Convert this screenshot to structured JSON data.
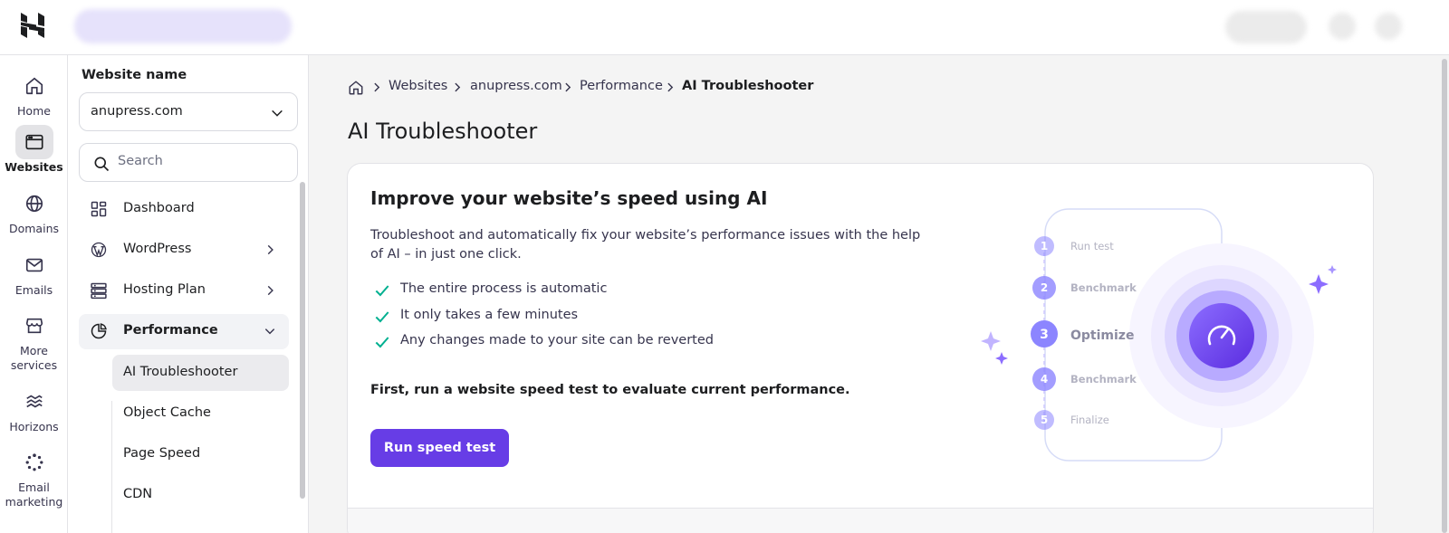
{
  "rail": [
    {
      "label": "Home",
      "icon": "home-icon"
    },
    {
      "label": "Websites",
      "icon": "browser-window-icon",
      "active": true
    },
    {
      "label": "Domains",
      "icon": "globe-icon"
    },
    {
      "label": "Emails",
      "icon": "mail-icon"
    },
    {
      "label": "More services",
      "icon": "store-icon"
    },
    {
      "label": "Horizons",
      "icon": "waves-icon"
    },
    {
      "label": "Email marketing",
      "icon": "loader-icon"
    }
  ],
  "sidebar": {
    "title": "Website name",
    "selected_site": "anupress.com",
    "search_placeholder": "Search",
    "items": [
      {
        "label": "Dashboard",
        "icon": "dashboard-icon"
      },
      {
        "label": "WordPress",
        "icon": "wordpress-icon"
      },
      {
        "label": "Hosting Plan",
        "icon": "server-icon"
      },
      {
        "label": "Performance",
        "icon": "pie-chart-icon",
        "expanded": true
      }
    ],
    "sub_items": [
      {
        "label": "AI Troubleshooter",
        "active": true
      },
      {
        "label": "Object Cache"
      },
      {
        "label": "Page Speed"
      },
      {
        "label": "CDN"
      }
    ]
  },
  "breadcrumb": [
    "Websites",
    "anupress.com",
    "Performance",
    "AI Troubleshooter"
  ],
  "page_title": "AI Troubleshooter",
  "card": {
    "heading": "Improve your website’s speed using AI",
    "description": "Troubleshoot and automatically fix your website’s performance issues with the help of AI – in just one click.",
    "checks": [
      "The entire process is automatic",
      "It only takes a few minutes",
      "Any changes made to your site can be reverted"
    ],
    "prompt": "First, run a website speed test to evaluate current performance.",
    "button_label": "Run speed test"
  },
  "steps": [
    {
      "num": "1",
      "label": "Run test"
    },
    {
      "num": "2",
      "label": "Benchmark"
    },
    {
      "num": "3",
      "label": "Optimize",
      "current": true
    },
    {
      "num": "4",
      "label": "Benchmark"
    },
    {
      "num": "5",
      "label": "Finalize"
    }
  ],
  "colors": {
    "accent": "#673de6",
    "check": "#00b090",
    "step_circle": "#8c85ff"
  }
}
